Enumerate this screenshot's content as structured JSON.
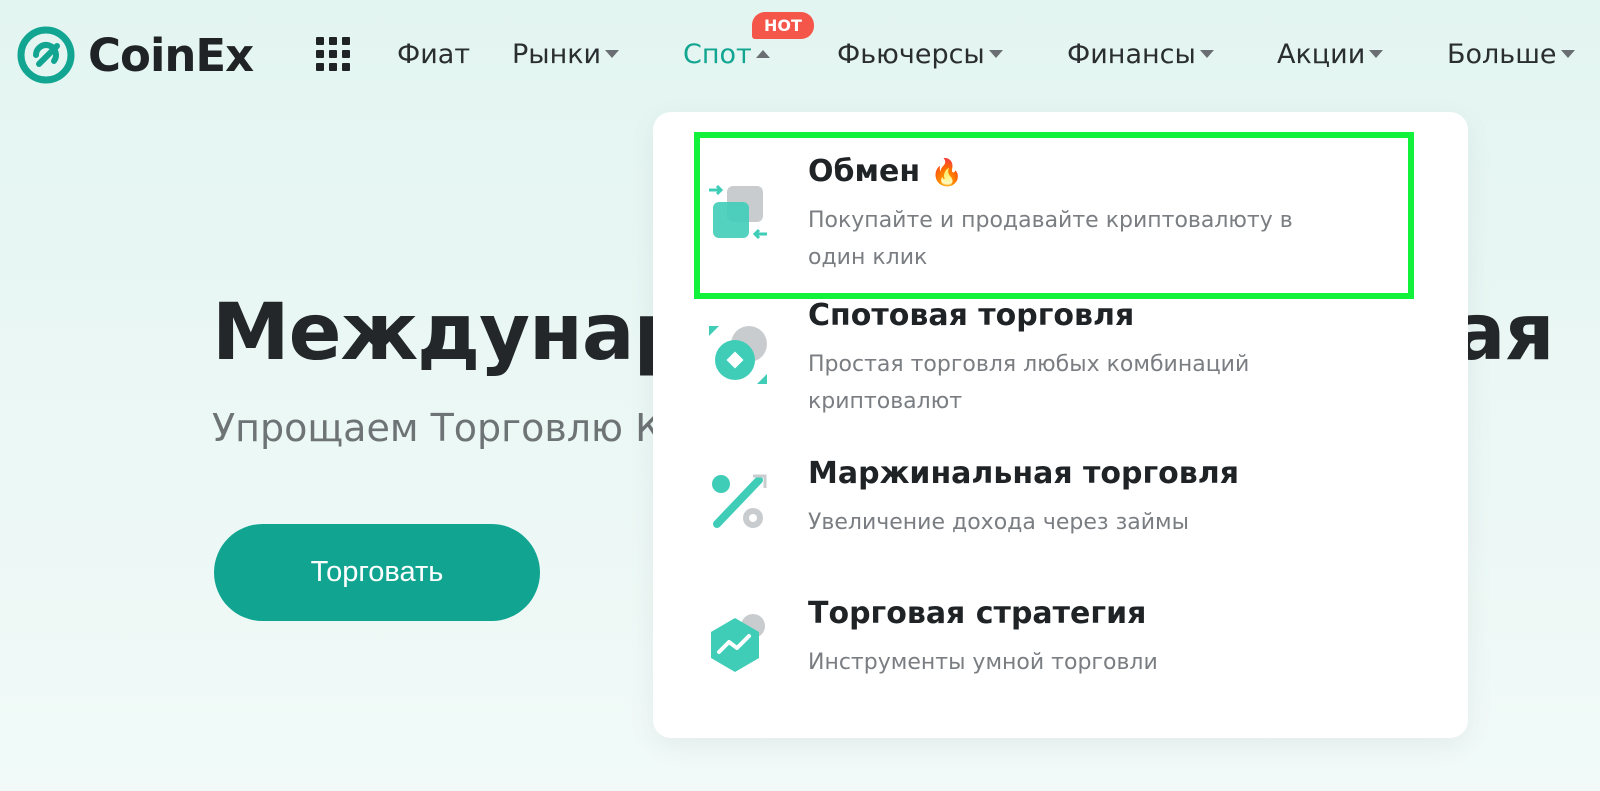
{
  "logo": {
    "text": "CoinEx"
  },
  "nav": {
    "fiat": "Фиат",
    "markets": "Рынки",
    "spot": "Спот",
    "futures": "Фьючерсы",
    "finance": "Финансы",
    "shares": "Акции",
    "more": "Больше",
    "hot_badge": "HOT"
  },
  "hero": {
    "title": "Междунаро",
    "title_tail": "ная",
    "subtitle": "Упрощаем Торговлю К",
    "cta": "Торговать"
  },
  "dropdown": {
    "items": [
      {
        "title": "Обмен",
        "desc": "Покупайте и продавайте криптовалюту в один клик",
        "icon": "exchange-icon"
      },
      {
        "title": "Спотовая торговля",
        "desc": "Простая торговля любых комбинаций криптовалют",
        "icon": "spot-trading-icon"
      },
      {
        "title": "Маржинальная торговля",
        "desc": "Увеличение дохода через займы",
        "icon": "margin-percent-icon"
      },
      {
        "title": "Торговая стратегия",
        "desc": "Инструменты умной торговли",
        "icon": "strategy-chart-icon"
      }
    ]
  },
  "colors": {
    "accent": "#12a591",
    "hot": "#f5564a",
    "highlight": "#12f23a"
  }
}
